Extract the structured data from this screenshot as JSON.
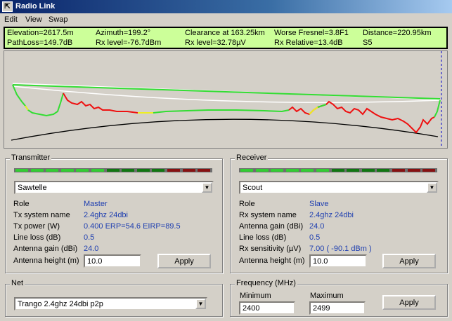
{
  "window": {
    "title": "Radio Link"
  },
  "menu": [
    "Edit",
    "View",
    "Swap"
  ],
  "info": {
    "row1": [
      "Elevation=2617.5m",
      "Azimuth=199.2°",
      "Clearance at 163.25km",
      "Worse Fresnel=3.8F1",
      "Distance=220.95km"
    ],
    "row2": [
      "PathLoss=149.7dB",
      "Rx level=-76.7dBm",
      "Rx level=32.78µV",
      "Rx Relative=13.4dB",
      "S5"
    ]
  },
  "colors": {
    "info_bg": "#ccff99",
    "value_text": "#1f3fb0",
    "terrain_clear": "#33dd33",
    "terrain_obstructed": "#ee1111",
    "terrain_marginal": "#eeee22"
  },
  "meter": [
    "#33cc33",
    "#33cc33",
    "#33cc33",
    "#33cc33",
    "#33cc33",
    "#33cc33",
    "#117711",
    "#117711",
    "#117711",
    "#117711",
    "#881111",
    "#881111",
    "#881111"
  ],
  "transmitter": {
    "legend": "Transmitter",
    "site": "Sawtelle",
    "rows": [
      {
        "label": "Role",
        "value": "Master"
      },
      {
        "label": "Tx system name",
        "value": "2.4ghz 24dbi"
      },
      {
        "label": "Tx power (W)",
        "value": "0.400   ERP=54.6  EIRP=89.5"
      },
      {
        "label": "Line loss (dB)",
        "value": "0.5"
      },
      {
        "label": "Antenna gain (dBi)",
        "value": "24.0"
      }
    ],
    "height_label": "Antenna height (m)",
    "height_value": "10.0",
    "apply": "Apply"
  },
  "receiver": {
    "legend": "Receiver",
    "site": "Scout",
    "rows": [
      {
        "label": "Role",
        "value": "Slave"
      },
      {
        "label": "Rx system name",
        "value": "2.4ghz 24dbi"
      },
      {
        "label": "Antenna gain (dBi)",
        "value": "24.0"
      },
      {
        "label": "Line loss (dB)",
        "value": "0.5"
      },
      {
        "label": "Rx sensitivity (µV)",
        "value": "7.00  ( -90.1 dBm )"
      }
    ],
    "height_label": "Antenna height (m)",
    "height_value": "10.0",
    "apply": "Apply"
  },
  "net": {
    "legend": "Net",
    "selected": "Trango 2.4ghz 24dbi p2p"
  },
  "frequency": {
    "legend": "Frequency (MHz)",
    "min_label": "Minimum",
    "min_value": "2400",
    "max_label": "Maximum",
    "max_value": "2499",
    "apply": "Apply"
  }
}
